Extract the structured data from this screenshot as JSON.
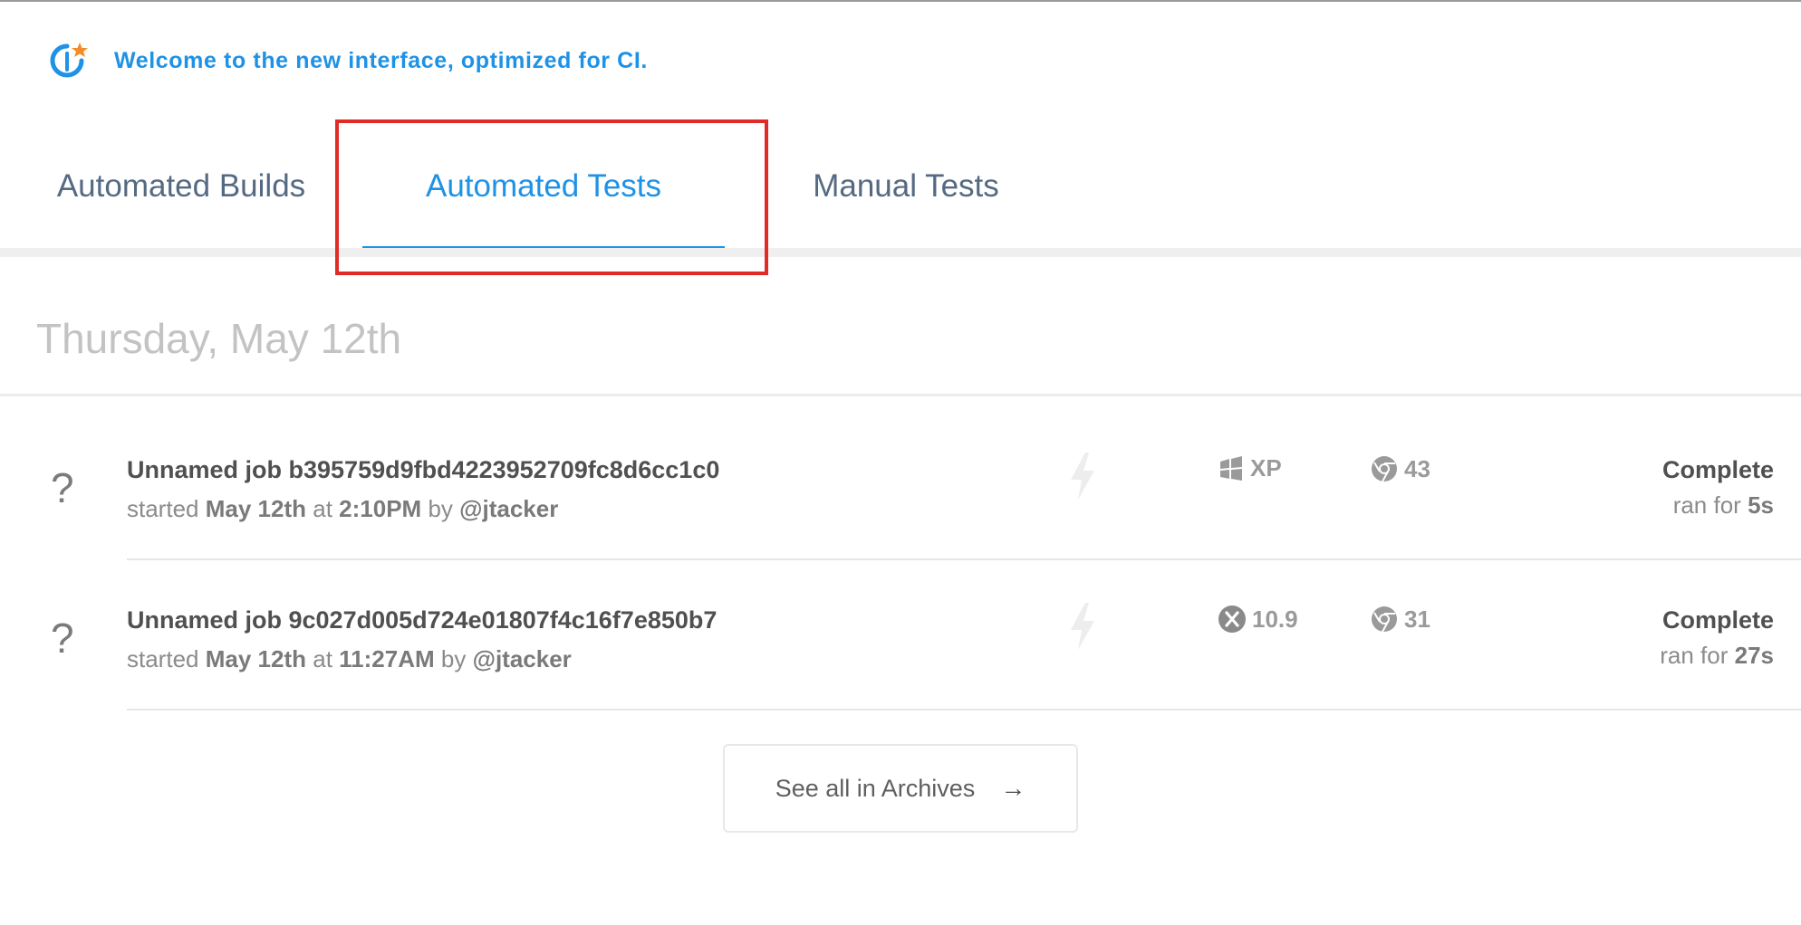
{
  "banner": {
    "message": "Welcome to the new interface, optimized for CI."
  },
  "tabs": [
    {
      "label": "Automated Builds",
      "active": false
    },
    {
      "label": "Automated Tests",
      "active": true
    },
    {
      "label": "Manual Tests",
      "active": false
    }
  ],
  "date_heading": "Thursday, May 12th",
  "jobs": [
    {
      "status_icon": "?",
      "title": "Unnamed job b395759d9fbd4223952709fc8d6cc1c0",
      "started_prefix": "started",
      "date": "May 12th",
      "at": "at",
      "time": "2:10PM",
      "by": "by",
      "user": "@jtacker",
      "os_icon": "windows-icon",
      "os": "XP",
      "browser_icon": "chrome-icon",
      "browser_version": "43",
      "state": "Complete",
      "ran_for_prefix": "ran for",
      "duration": "5s"
    },
    {
      "status_icon": "?",
      "title": "Unnamed job 9c027d005d724e01807f4c16f7e850b7",
      "started_prefix": "started",
      "date": "May 12th",
      "at": "at",
      "time": "11:27AM",
      "by": "by",
      "user": "@jtacker",
      "os_icon": "mac-osx-icon",
      "os": "10.9",
      "browser_icon": "chrome-icon",
      "browser_version": "31",
      "state": "Complete",
      "ran_for_prefix": "ran for",
      "duration": "27s"
    }
  ],
  "archives_button": {
    "label": "See all in Archives",
    "arrow": "→"
  },
  "colors": {
    "accent": "#1e92e6",
    "highlight": "#e02b27"
  }
}
